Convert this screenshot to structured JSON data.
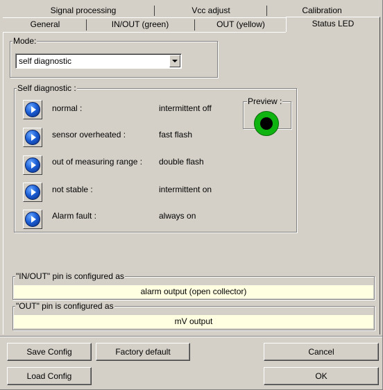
{
  "tabs": {
    "row1": [
      "Signal processing",
      "Vcc adjust",
      "Calibration"
    ],
    "row2": [
      "General",
      "IN/OUT (green)",
      "OUT (yellow)",
      "Status LED"
    ],
    "active": "Status LED"
  },
  "mode": {
    "legend": "Mode:",
    "selected": "self diagnostic"
  },
  "self_diagnostic": {
    "legend": "Self diagnostic :",
    "items": [
      {
        "label": "normal :",
        "value": "intermittent off"
      },
      {
        "label": "sensor overheated :",
        "value": "fast flash"
      },
      {
        "label": "out of measuring range :",
        "value": "double flash"
      },
      {
        "label": "not stable :",
        "value": "intermittent on"
      },
      {
        "label": "Alarm fault :",
        "value": "always on"
      }
    ],
    "preview_legend": "Preview :",
    "preview_color": "#10b410"
  },
  "pins": {
    "inout_legend": "\"IN/OUT\" pin is configured as",
    "inout_value": "alarm output (open collector)",
    "out_legend": "\"OUT\" pin is configured as",
    "out_value": "mV output"
  },
  "buttons": {
    "save": "Save Config",
    "factory": "Factory default",
    "cancel": "Cancel",
    "load": "Load Config",
    "ok": "OK"
  }
}
